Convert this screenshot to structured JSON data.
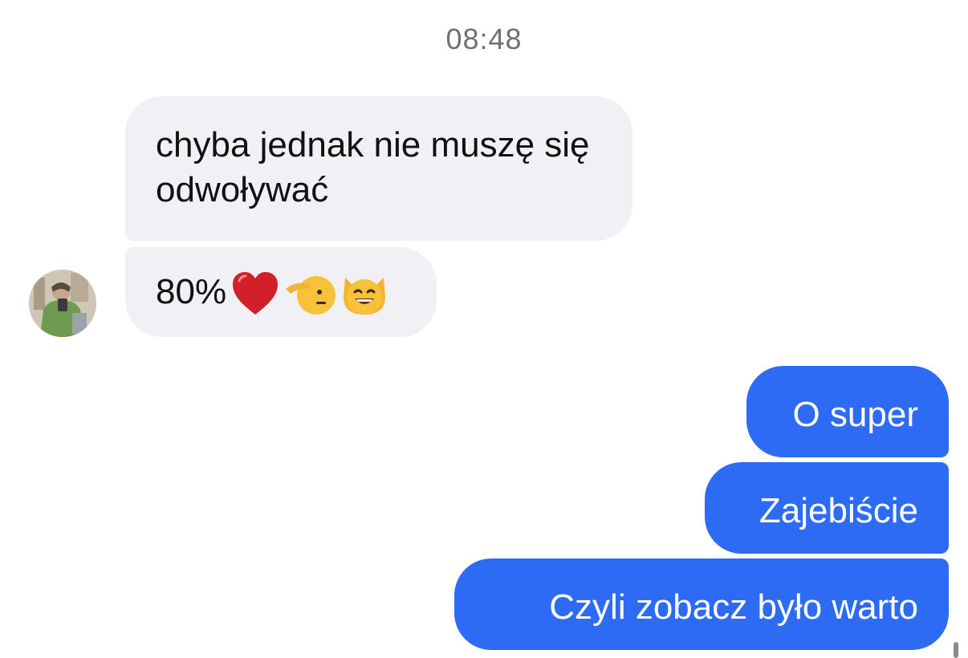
{
  "conversation": {
    "timestamp": "08:48",
    "messages": [
      {
        "direction": "incoming",
        "text": "chyba jednak nie muszę się odwoływać"
      },
      {
        "direction": "incoming",
        "text": "80%",
        "emojis": [
          "red-heart-icon",
          "saluting-face-icon",
          "grinning-cat-icon"
        ]
      },
      {
        "direction": "outgoing",
        "text": "O super"
      },
      {
        "direction": "outgoing",
        "text": "Zajebiście"
      },
      {
        "direction": "outgoing",
        "text": "Czyli zobacz było warto"
      }
    ]
  },
  "colors": {
    "incoming_bubble": "#f0f0f5",
    "outgoing_bubble": "#2d6bf5",
    "timestamp_text": "#6f6f74"
  }
}
